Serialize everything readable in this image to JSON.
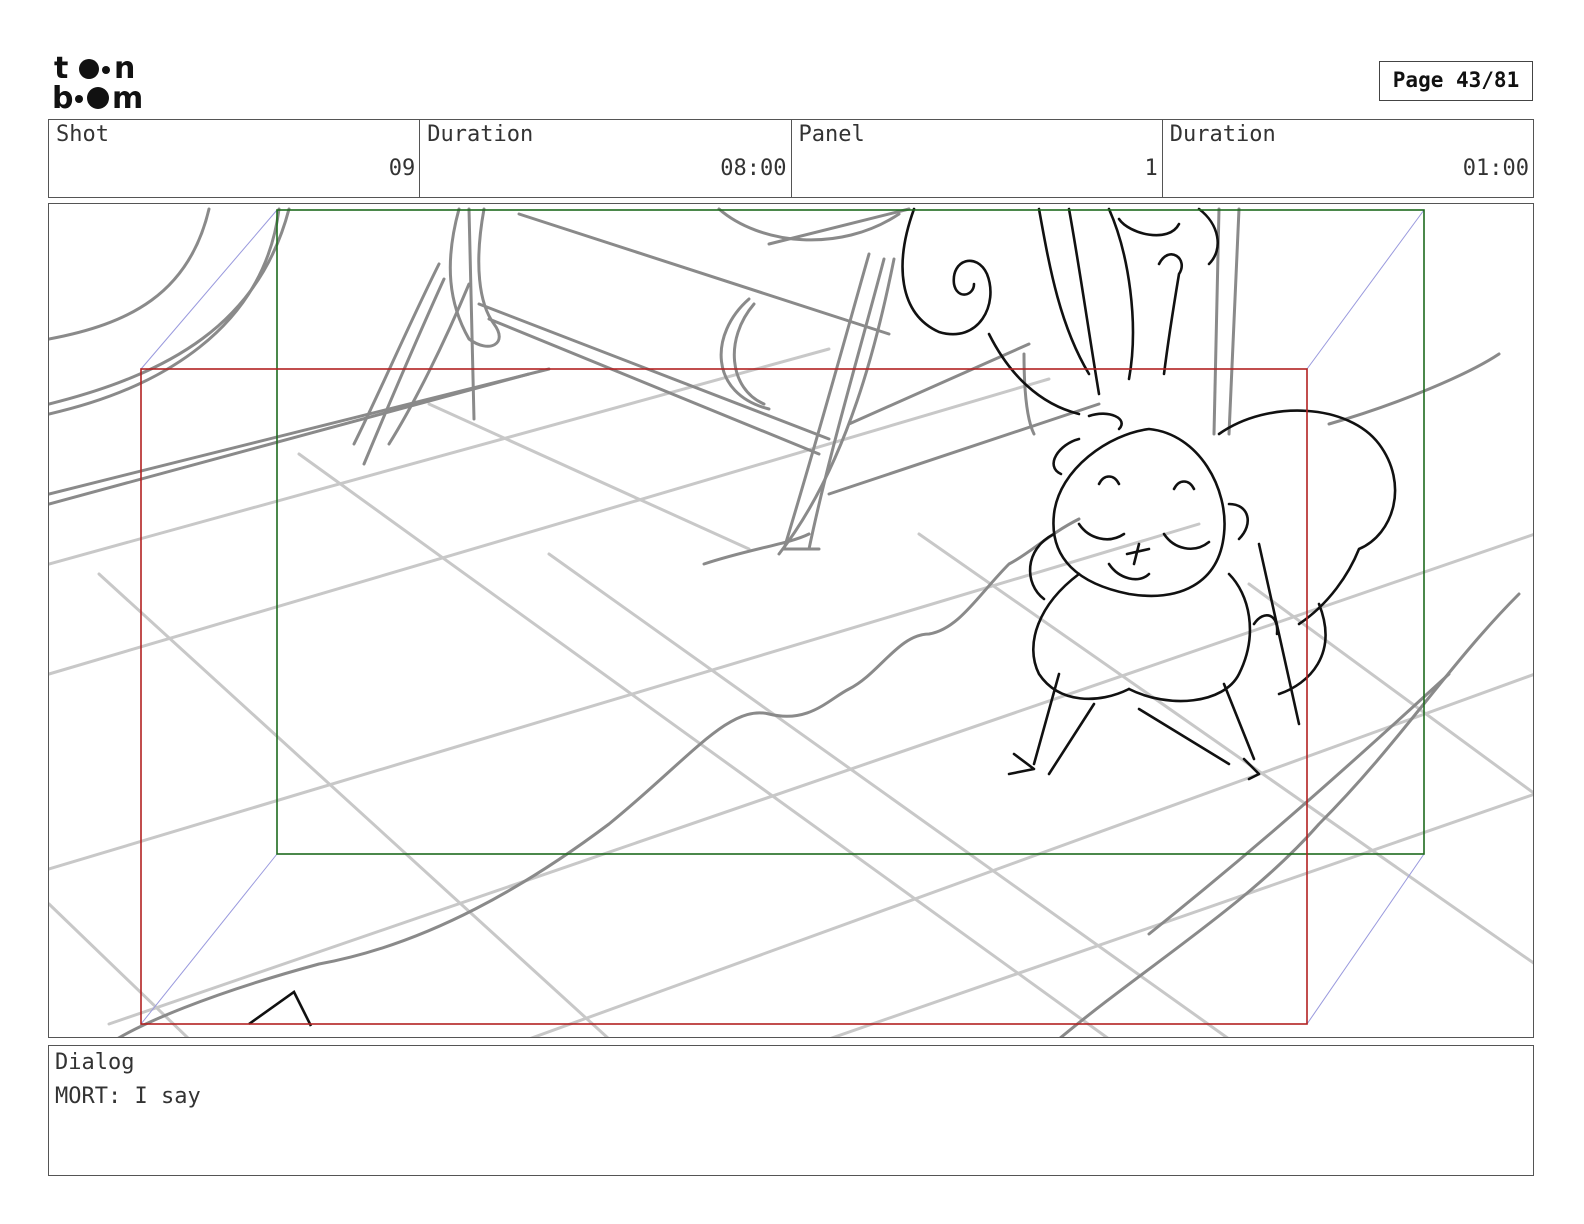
{
  "logo": {
    "text": "toon boom"
  },
  "page": {
    "label": "Page 43/81"
  },
  "header": {
    "shot": {
      "label": "Shot",
      "value": "09"
    },
    "shot_duration": {
      "label": "Duration",
      "value": "08:00"
    },
    "panel": {
      "label": "Panel",
      "value": "1"
    },
    "panel_duration": {
      "label": "Duration",
      "value": "01:00"
    }
  },
  "frames": {
    "safe_color": "#1e6b1e",
    "camera_color": "#b22222",
    "guide_color": "#9999dd"
  },
  "dialog": {
    "label": "Dialog",
    "text": "MORT: I say"
  }
}
